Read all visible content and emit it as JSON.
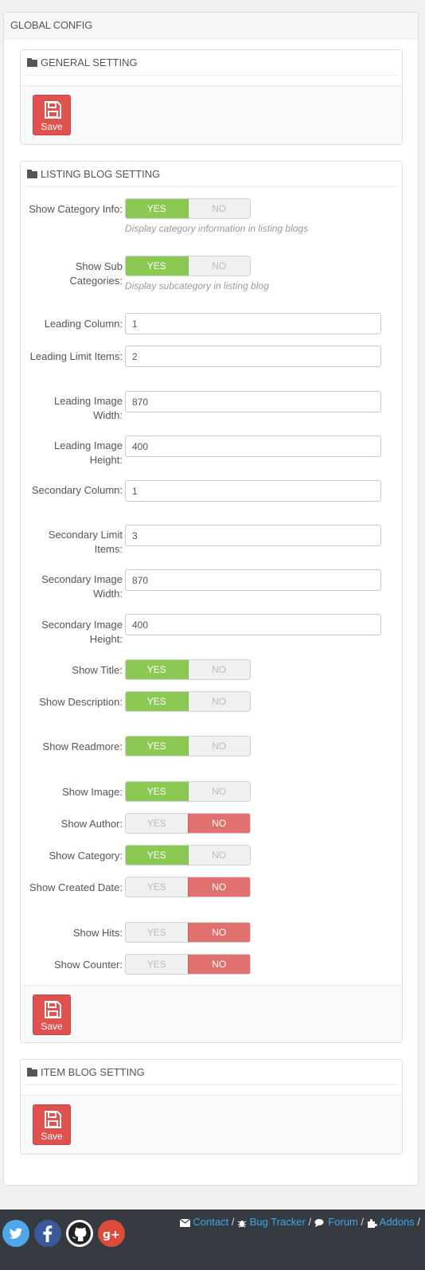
{
  "global": {
    "title": "GLOBAL CONFIG"
  },
  "general": {
    "title": "GENERAL SETTING",
    "save": "Save"
  },
  "listing": {
    "title": "LISTING BLOG SETTING",
    "save": "Save",
    "yes": "YES",
    "no": "NO",
    "show_category_info": {
      "label": "Show Category Info:",
      "value": "YES",
      "help": "Display category information in listing blogs"
    },
    "show_sub_categories": {
      "label": "Show Sub Categories:",
      "value": "YES",
      "help": "Display subcategory in listing blog"
    },
    "leading_column": {
      "label": "Leading Column:",
      "value": "1"
    },
    "leading_limit_items": {
      "label": "Leading Limit Items:",
      "value": "2"
    },
    "leading_image_width": {
      "label": "Leading Image Width:",
      "value": "870"
    },
    "leading_image_height": {
      "label": "Leading Image Height:",
      "value": "400"
    },
    "secondary_column": {
      "label": "Secondary Column:",
      "value": "1"
    },
    "secondary_limit_items": {
      "label": "Secondary Limit Items:",
      "value": "3"
    },
    "secondary_image_width": {
      "label": "Secondary Image Width:",
      "value": "870"
    },
    "secondary_image_height": {
      "label": "Secondary Image Height:",
      "value": "400"
    },
    "show_title": {
      "label": "Show Title:",
      "value": "YES"
    },
    "show_description": {
      "label": "Show Description:",
      "value": "YES"
    },
    "show_readmore": {
      "label": "Show Readmore:",
      "value": "YES"
    },
    "show_image": {
      "label": "Show Image:",
      "value": "YES"
    },
    "show_author": {
      "label": "Show Author:",
      "value": "NO"
    },
    "show_category": {
      "label": "Show Category:",
      "value": "YES"
    },
    "show_created_date": {
      "label": "Show Created Date:",
      "value": "NO"
    },
    "show_hits": {
      "label": "Show Hits:",
      "value": "NO"
    },
    "show_counter": {
      "label": "Show Counter:",
      "value": "NO"
    }
  },
  "item": {
    "title": "ITEM BLOG SETTING",
    "save": "Save"
  },
  "footer": {
    "contact": "Contact",
    "bug_tracker": "Bug Tracker",
    "forum": "Forum",
    "addons": "Addons",
    "separator": "/",
    "icons": [
      "twitter-icon",
      "facebook-icon",
      "github-icon",
      "google-plus-icon"
    ]
  },
  "colors": {
    "yes_on": "#8bc954",
    "no_on": "#e0716f",
    "save": "#e0524f",
    "link": "#3ea6e8",
    "footer_bg": "#363a41"
  }
}
